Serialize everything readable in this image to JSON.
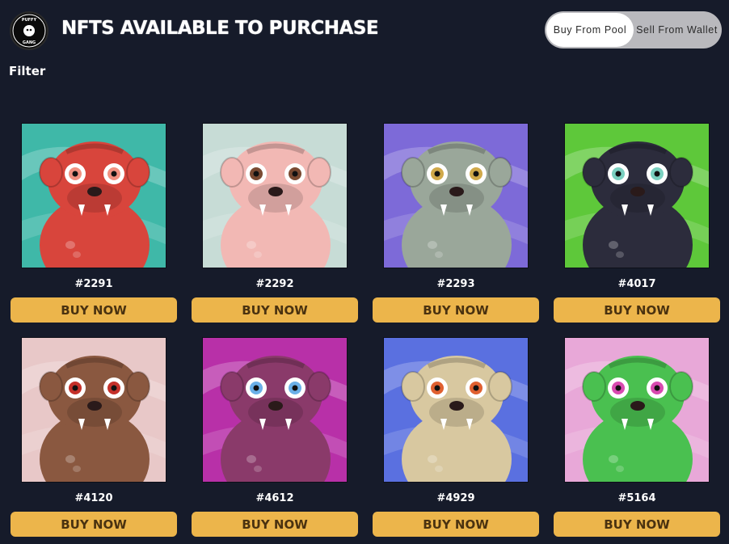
{
  "header": {
    "logo_text": "PUFFY GANG",
    "title": "NFTS AVAILABLE TO PURCHASE"
  },
  "toggle": {
    "options": [
      {
        "label": "Buy From Pool",
        "active": true
      },
      {
        "label": "Sell From Wallet",
        "active": false
      }
    ]
  },
  "filter": {
    "label": "Filter"
  },
  "cards": [
    {
      "id": "#2291",
      "button": "BUY NOW",
      "bg": "#3fb8a8",
      "body": "#d8453c",
      "accent": "#f09080",
      "icon": "puffy-red-monocle"
    },
    {
      "id": "#2292",
      "button": "BUY NOW",
      "bg": "#c7dcd6",
      "body": "#f2b8b4",
      "accent": "#7a4a32",
      "icon": "puffy-pink-horns"
    },
    {
      "id": "#2293",
      "button": "BUY NOW",
      "bg": "#7d6ad8",
      "body": "#9aa79a",
      "accent": "#d0a94a",
      "icon": "puffy-grey-fox"
    },
    {
      "id": "#4017",
      "button": "BUY NOW",
      "bg": "#5ec83a",
      "body": "#2c2c3c",
      "accent": "#7ad0c0",
      "icon": "puffy-black-chain"
    },
    {
      "id": "#4120",
      "button": "BUY NOW",
      "bg": "#e8c8c8",
      "body": "#8a5840",
      "accent": "#c4302a",
      "icon": "puffy-brown-beard"
    },
    {
      "id": "#4612",
      "button": "BUY NOW",
      "bg": "#b830a8",
      "body": "#8a3a6a",
      "accent": "#6ab0e8",
      "icon": "puffy-purple-headphones"
    },
    {
      "id": "#4929",
      "button": "BUY NOW",
      "bg": "#5a70e0",
      "body": "#d8c8a0",
      "accent": "#e06030",
      "icon": "puffy-tan-rose"
    },
    {
      "id": "#5164",
      "button": "BUY NOW",
      "bg": "#e8a8d8",
      "body": "#4ac050",
      "accent": "#d84ab0",
      "icon": "puffy-green-tongue"
    }
  ]
}
